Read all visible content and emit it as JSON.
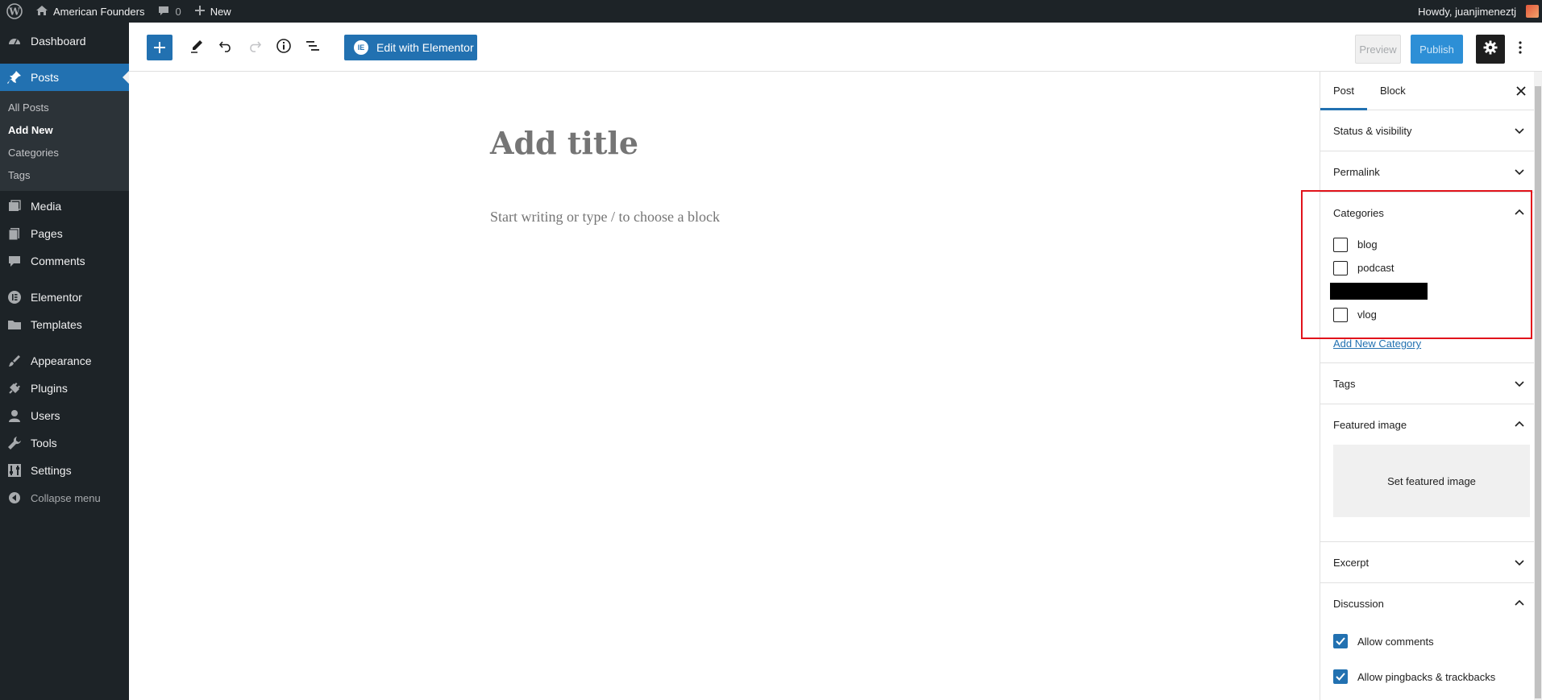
{
  "adminbar": {
    "site_name": "American Founders",
    "comments_count": "0",
    "new_label": "New",
    "greeting": "Howdy, juanjimeneztj"
  },
  "sidebar": {
    "dashboard": "Dashboard",
    "posts": "Posts",
    "posts_sub": [
      "All Posts",
      "Add New",
      "Categories",
      "Tags"
    ],
    "media": "Media",
    "pages": "Pages",
    "comments": "Comments",
    "elementor": "Elementor",
    "templates": "Templates",
    "appearance": "Appearance",
    "plugins": "Plugins",
    "users": "Users",
    "tools": "Tools",
    "settings": "Settings",
    "collapse": "Collapse menu"
  },
  "toolbar": {
    "elementor_label": "Edit with Elementor",
    "elementor_badge": "IE",
    "preview_label": "Preview",
    "publish_label": "Publish"
  },
  "editor": {
    "title_placeholder": "Add title",
    "block_placeholder": "Start writing or type / to choose a block"
  },
  "settings_panel": {
    "tabs": [
      "Post",
      "Block"
    ],
    "status_visibility": "Status & visibility",
    "permalink": "Permalink",
    "categories_title": "Categories",
    "categories": [
      {
        "label": "blog",
        "checked": false
      },
      {
        "label": "podcast",
        "checked": false
      },
      {
        "label": "vlog",
        "checked": false
      }
    ],
    "add_new_category": "Add New Category",
    "tags": "Tags",
    "featured_image": "Featured image",
    "set_featured_image": "Set featured image",
    "excerpt": "Excerpt",
    "discussion": "Discussion",
    "allow_comments": "Allow comments",
    "allow_pingbacks": "Allow pingbacks & trackbacks"
  },
  "colors": {
    "accent": "#2271b1",
    "admin_dark": "#1d2327",
    "highlight": "#e1131b"
  }
}
